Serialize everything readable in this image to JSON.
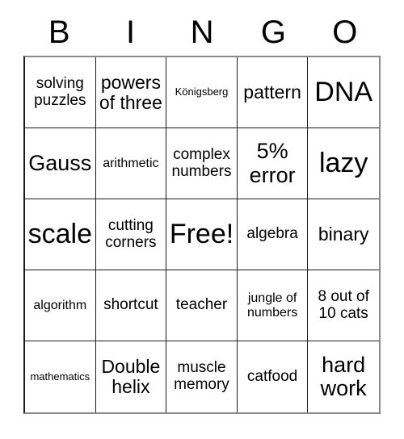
{
  "card": {
    "title": "BINGO",
    "header_letters": [
      "B",
      "I",
      "N",
      "G",
      "O"
    ],
    "free_space_label": "Free!",
    "grid_size": "5x5",
    "colors": {
      "background": "#ffffff",
      "text": "#000000",
      "grid_line": "#1a1a1a",
      "outer_border": "#888888"
    },
    "rows": [
      [
        {
          "text": "solving puzzles",
          "size": "s-md",
          "free": false
        },
        {
          "text": "powers of three",
          "size": "s-lg",
          "free": false
        },
        {
          "text": "Königsberg",
          "size": "s-xs",
          "free": false
        },
        {
          "text": "pattern",
          "size": "s-lg",
          "free": false
        },
        {
          "text": "DNA",
          "size": "s-xxl",
          "free": false
        }
      ],
      [
        {
          "text": "Gauss",
          "size": "s-xl",
          "free": false
        },
        {
          "text": "arithmetic",
          "size": "s-sm",
          "free": false
        },
        {
          "text": "complex numbers",
          "size": "s-md",
          "free": false
        },
        {
          "text": "5% error",
          "size": "s-xl",
          "free": false
        },
        {
          "text": "lazy",
          "size": "s-xxl",
          "free": false
        }
      ],
      [
        {
          "text": "scale",
          "size": "s-xxl",
          "free": false
        },
        {
          "text": "cutting corners",
          "size": "s-md",
          "free": false
        },
        {
          "text": "Free!",
          "size": "s-xxl",
          "free": true
        },
        {
          "text": "algebra",
          "size": "s-md",
          "free": false
        },
        {
          "text": "binary",
          "size": "s-lg",
          "free": false
        }
      ],
      [
        {
          "text": "algorithm",
          "size": "s-sm",
          "free": false
        },
        {
          "text": "shortcut",
          "size": "s-md",
          "free": false
        },
        {
          "text": "teacher",
          "size": "s-md",
          "free": false
        },
        {
          "text": "jungle of numbers",
          "size": "s-sm",
          "free": false
        },
        {
          "text": "8 out of 10 cats",
          "size": "s-md",
          "free": false
        }
      ],
      [
        {
          "text": "mathematics",
          "size": "s-xs",
          "free": false
        },
        {
          "text": "Double helix",
          "size": "s-lg",
          "free": false
        },
        {
          "text": "muscle memory",
          "size": "s-md",
          "free": false
        },
        {
          "text": "catfood",
          "size": "s-md",
          "free": false
        },
        {
          "text": "hard work",
          "size": "s-xl",
          "free": false
        }
      ]
    ]
  }
}
